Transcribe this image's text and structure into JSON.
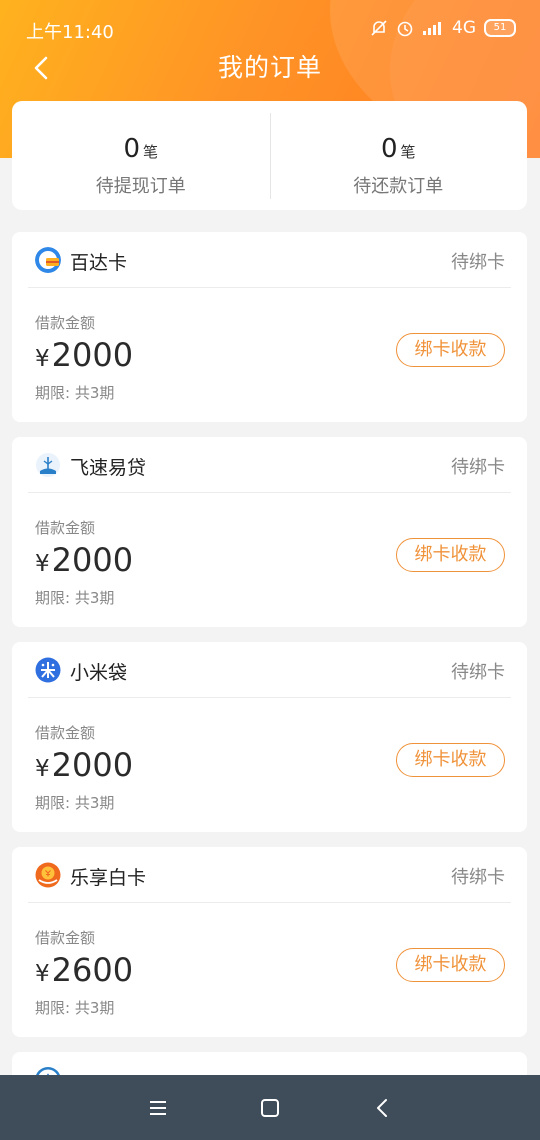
{
  "status": {
    "time": "上午11:40",
    "network": "4G",
    "battery": "51"
  },
  "header": {
    "title": "我的订单"
  },
  "summary": [
    {
      "count": "0",
      "unit": "笔",
      "label": "待提现订单"
    },
    {
      "count": "0",
      "unit": "笔",
      "label": "待还款订单"
    }
  ],
  "orders": [
    {
      "name": "百达卡",
      "status": "待绑卡",
      "amount_label": "借款金额",
      "currency": "¥",
      "amount": "2000",
      "term": "期限: 共3期",
      "action": "绑卡收款"
    },
    {
      "name": "飞速易贷",
      "status": "待绑卡",
      "amount_label": "借款金额",
      "currency": "¥",
      "amount": "2000",
      "term": "期限: 共3期",
      "action": "绑卡收款"
    },
    {
      "name": "小米袋",
      "status": "待绑卡",
      "amount_label": "借款金额",
      "currency": "¥",
      "amount": "2000",
      "term": "期限: 共3期",
      "action": "绑卡收款"
    },
    {
      "name": "乐享白卡",
      "status": "待绑卡",
      "amount_label": "借款金额",
      "currency": "¥",
      "amount": "2600",
      "term": "期限: 共3期",
      "action": "绑卡收款"
    }
  ],
  "icons": {
    "back": "chevron-left-icon",
    "nav_menu": "menu-icon",
    "nav_home": "square-icon",
    "nav_back": "chevron-left-icon"
  },
  "colors": {
    "accent": "#f0923a",
    "header": "#ff8a24",
    "navbar": "#3f4d5a"
  }
}
